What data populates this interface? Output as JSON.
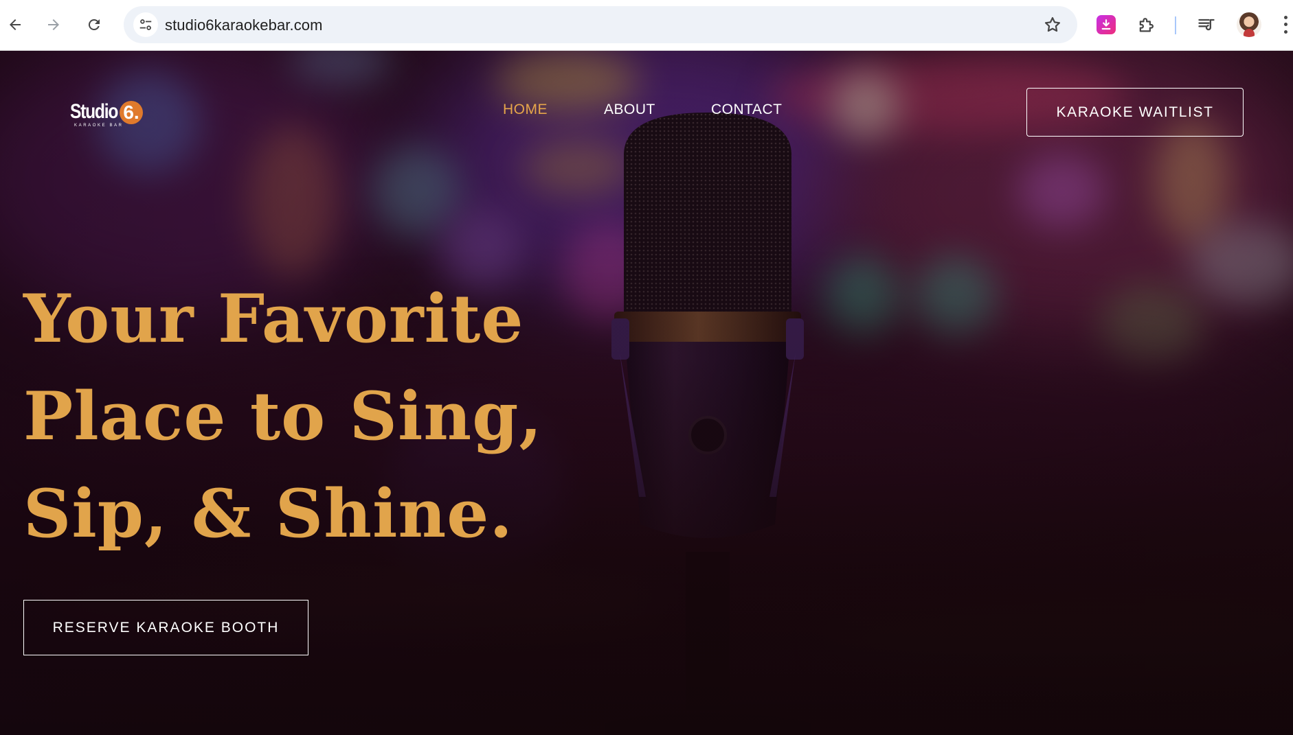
{
  "browser": {
    "url": "studio6karaokebar.com",
    "back_icon": "arrow-left-icon",
    "forward_icon": "arrow-right-icon",
    "reload_icon": "reload-icon",
    "site_info_icon": "tune-icon",
    "bookmark_icon": "star-icon",
    "extensions": [
      "download-extension-icon",
      "puzzle-icon",
      "media-queue-icon"
    ],
    "menu_icon": "kebab-menu-icon"
  },
  "site": {
    "logo": {
      "name": "Studio6",
      "tagline": "KARAOKE BAR"
    },
    "nav": [
      {
        "label": "HOME",
        "active": true
      },
      {
        "label": "ABOUT",
        "active": false
      },
      {
        "label": "CONTACT",
        "active": false
      }
    ],
    "waitlist_label": "KARAOKE WAITLIST",
    "headline": [
      "Your Favorite",
      "Place to Sing,",
      "Sip, & Shine."
    ],
    "reserve_label": "RESERVE KARAOKE BOOTH"
  },
  "colors": {
    "accent": "#e1a44b",
    "nav_active": "#e6a64a",
    "text": "#ffffff"
  }
}
